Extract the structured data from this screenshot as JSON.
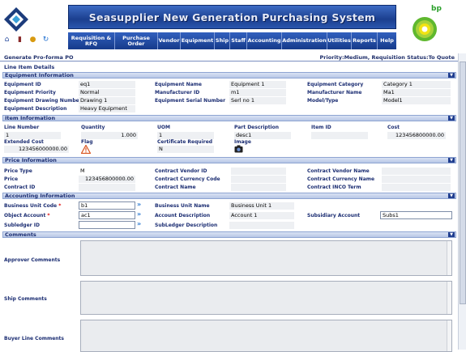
{
  "app": {
    "banner_title": "Seasupplier New Generation Purchasing System",
    "bp_text": "bp"
  },
  "toolbar_icons": [
    "home-icon",
    "exit-icon",
    "user-icon",
    "refresh-icon"
  ],
  "menu": [
    "Requisition & RFQ",
    "Purchase Order",
    "Vendor",
    "Equipment",
    "Ship",
    "Staff",
    "Accounting",
    "Administration",
    "Utilities",
    "Reports",
    "Help"
  ],
  "page": {
    "title": "Generate Pro-forma PO",
    "status": "Priority:Medium, Requisition Status:To Quote",
    "subtitle": "Line Item Details"
  },
  "equipment": {
    "header": "Equipment Information",
    "id_label": "Equipment ID",
    "id": "eq1",
    "name_label": "Equipment Name",
    "name": "Equipment 1",
    "category_label": "Equipment Category",
    "category": "Category 1",
    "priority_label": "Equipment Priority",
    "priority": "Normal",
    "manufacturer_id_label": "Manufacturer ID",
    "manufacturer_id": "m1",
    "manufacturer_name_label": "Manufacturer Name",
    "manufacturer_name": "Ma1",
    "drawing_label": "Equipment Drawing Number",
    "drawing": "Drawing 1",
    "serial_label": "Equipment Serial Number",
    "serial": "Serl no 1",
    "model_label": "Model/Type",
    "model": "Model1",
    "desc_label": "Equipment Description",
    "desc": "Heavy Equipment"
  },
  "item": {
    "header": "Item Information",
    "line_label": "Line Number",
    "line": "1",
    "qty_label": "Quantity",
    "qty": "1.000",
    "uom_label": "UOM",
    "uom": "1",
    "part_label": "Part Description",
    "part": "desc1",
    "item_id_label": "Item ID",
    "item_id": "",
    "cost_label": "Cost",
    "cost": "123456800000.00",
    "ext_label": "Extended Cost",
    "ext": "123456000000.00",
    "flag_label": "Flag",
    "cert_label": "Certificate Required",
    "cert": "N",
    "image_label": "Image"
  },
  "price": {
    "header": "Price Information",
    "type_label": "Price Type",
    "type": "M",
    "cv_id_label": "Contract Vendor ID",
    "cv_id": "",
    "cv_name_label": "Contract Vendor Name",
    "cv_name": "",
    "price_label": "Price",
    "price": "123456800000.00",
    "cc_code_label": "Contract Currency Code",
    "cc_code": "",
    "cc_name_label": "Contract Currency Name",
    "cc_name": "",
    "cid_label": "Contract ID",
    "cid": "",
    "cname_label": "Contract Name",
    "cname": "",
    "inco_label": "Contract INCO Term",
    "inco": ""
  },
  "accounting": {
    "header": "Accounting Information",
    "bu_code_label": "Business Unit Code",
    "bu_code": "b1",
    "bu_name_label": "Business Unit Name",
    "bu_name": "Business Unit 1",
    "obj_label": "Object Account",
    "obj": "ac1",
    "acct_desc_label": "Account Description",
    "acct_desc": "Account 1",
    "subsid_label": "Subsidiary Account",
    "subsid": "Subs1",
    "subledger_label": "Subledger ID",
    "subledger": "",
    "subledger_desc_label": "SubLedger Description",
    "subledger_desc": "",
    "required_mark": "*"
  },
  "comments": {
    "header": "Comments",
    "approver_label": "Approver Comments",
    "ship_label": "Ship Comments",
    "buyer_label": "Buyer Line Comments"
  }
}
